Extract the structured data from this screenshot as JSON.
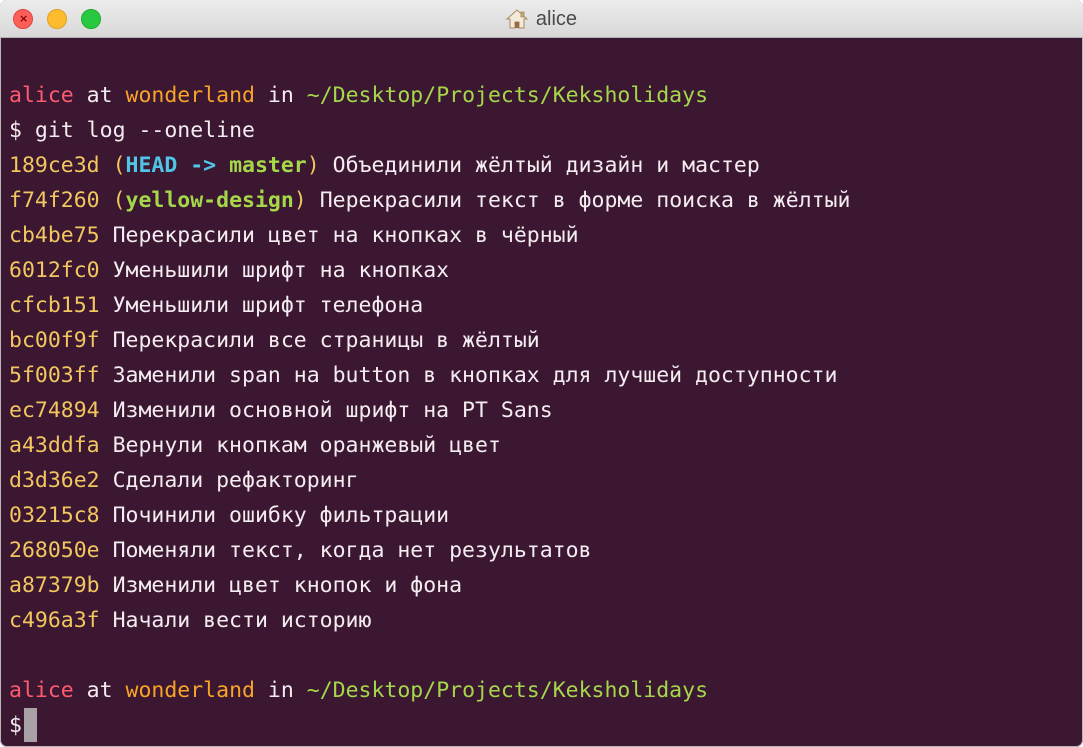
{
  "window": {
    "title": "alice",
    "title_icon": "home-icon",
    "controls": [
      "close",
      "minimize",
      "zoom"
    ]
  },
  "prompt": {
    "user": "alice",
    "at": " at ",
    "host": "wonderland",
    "in": " in ",
    "path": "~/Desktop/Projects/Keksholidays",
    "symbol": "$"
  },
  "command": "git log --oneline",
  "log": [
    {
      "hash": "189ce3d",
      "refs_kind": "head",
      "head": "HEAD",
      "arrow": " -> ",
      "branch": "master",
      "message": "Объединили жёлтый дизайн и мастер"
    },
    {
      "hash": "f74f260",
      "refs_kind": "branch",
      "branch": "yellow-design",
      "message": "Перекрасили текст в форме поиска в жёлтый"
    },
    {
      "hash": "cb4be75",
      "message": "Перекрасили цвет на кнопках в чёрный"
    },
    {
      "hash": "6012fc0",
      "message": "Уменьшили шрифт на кнопках"
    },
    {
      "hash": "cfcb151",
      "message": "Уменьшили шрифт телефона"
    },
    {
      "hash": "bc00f9f",
      "message": "Перекрасили все страницы в жёлтый"
    },
    {
      "hash": "5f003ff",
      "message": "Заменили span на button в кнопках для лучшей доступности"
    },
    {
      "hash": "ec74894",
      "message": "Изменили основной шрифт на PT Sans"
    },
    {
      "hash": "a43ddfa",
      "message": "Вернули кнопкам оранжевый цвет"
    },
    {
      "hash": "d3d36e2",
      "message": "Сделали рефакторинг"
    },
    {
      "hash": "03215c8",
      "message": "Починили ошибку фильтрации"
    },
    {
      "hash": "268050e",
      "message": "Поменяли текст, когда нет результатов"
    },
    {
      "hash": "a87379b",
      "message": "Изменили цвет кнопок и фона"
    },
    {
      "hash": "c496a3f",
      "message": "Начали вести историю"
    }
  ],
  "colors": {
    "background": "#3c1731",
    "user": "#fd5b71",
    "host": "#f7a428",
    "path": "#a4d84a",
    "hash": "#f2c75f",
    "head_ref": "#4fc6e8",
    "branch_ref": "#a4d84a",
    "text": "#f3ecf0"
  }
}
